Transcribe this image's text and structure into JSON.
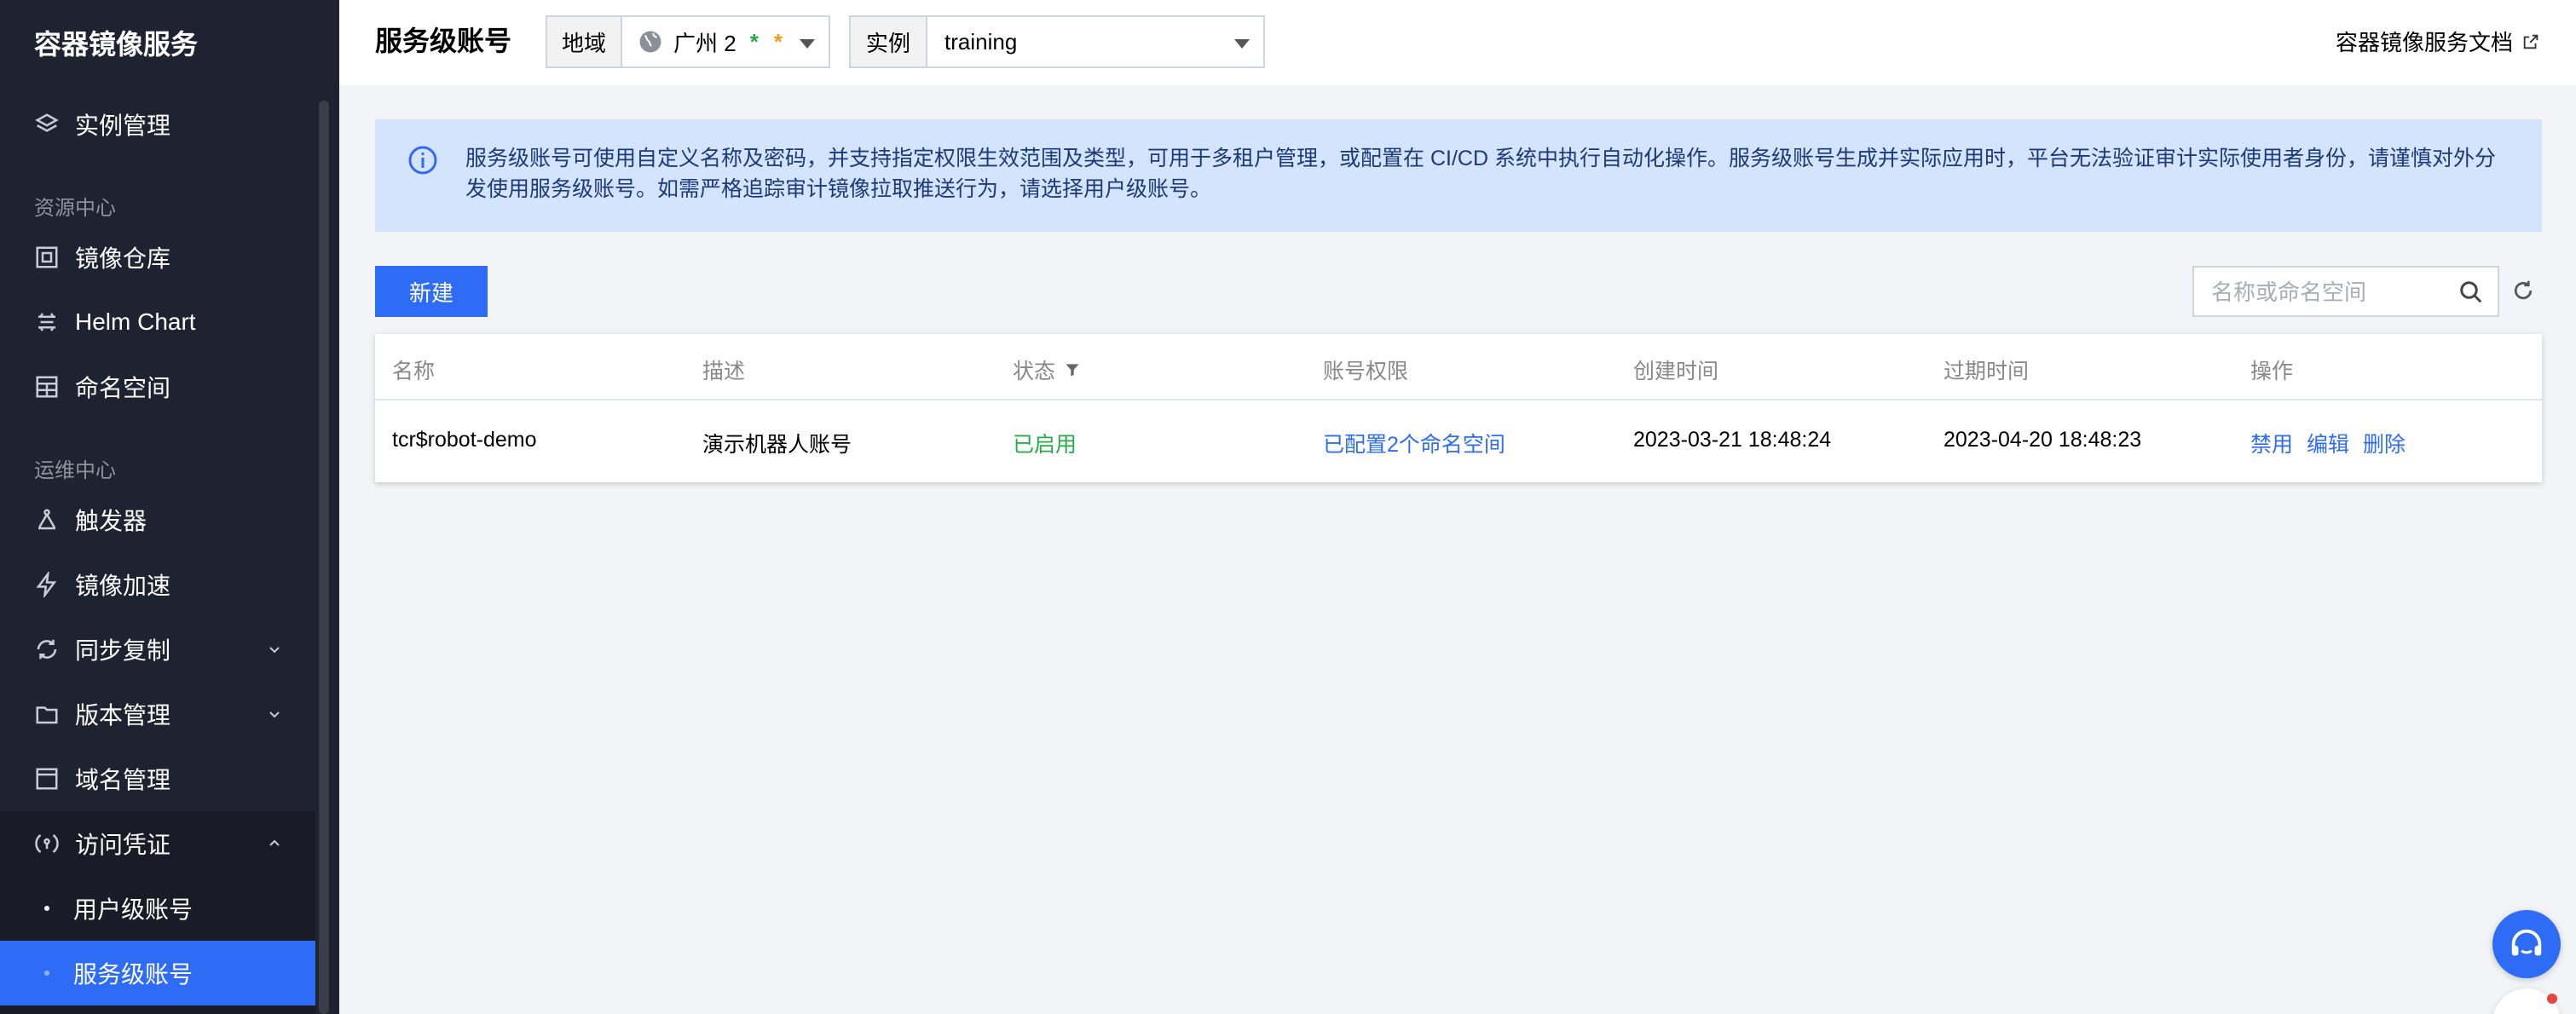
{
  "sidebar": {
    "title": "容器镜像服务",
    "items": {
      "instance": "实例管理",
      "section_resource": "资源中心",
      "repo": "镜像仓库",
      "helm": "Helm Chart",
      "namespace": "命名空间",
      "section_ops": "运维中心",
      "trigger": "触发器",
      "accel": "镜像加速",
      "sync": "同步复制",
      "version": "版本管理",
      "domain": "域名管理",
      "credential": "访问凭证",
      "user_account": "用户级账号",
      "service_account": "服务级账号"
    }
  },
  "header": {
    "title": "服务级账号",
    "region_label": "地域",
    "region_value": "广州 2",
    "instance_label": "实例",
    "instance_value": "training",
    "doc_link": "容器镜像服务文档"
  },
  "notice": {
    "text": "服务级账号可使用自定义名称及密码，并支持指定权限生效范围及类型，可用于多租户管理，或配置在 CI/CD 系统中执行自动化操作。服务级账号生成并实际应用时，平台无法验证审计实际使用者身份，请谨慎对外分发使用服务级账号。如需严格追踪审计镜像拉取推送行为，请选择用户级账号。"
  },
  "toolbar": {
    "new_button": "新建",
    "search_placeholder": "名称或命名空间"
  },
  "table": {
    "headers": {
      "name": "名称",
      "desc": "描述",
      "status": "状态",
      "perm": "账号权限",
      "created": "创建时间",
      "expires": "过期时间",
      "ops": "操作"
    },
    "rows": [
      {
        "name": "tcr$robot-demo",
        "desc": "演示机器人账号",
        "status": "已启用",
        "perm": "已配置2个命名空间",
        "created": "2023-03-21 18:48:24",
        "expires": "2023-04-20 18:48:23",
        "actions": {
          "disable": "禁用",
          "edit": "编辑",
          "delete": "删除"
        }
      }
    ]
  },
  "colors": {
    "sidebar_bg": "#1f2331",
    "accent": "#2f6cf6",
    "status_green": "#29a94a",
    "notice_bg": "#d5e4fd"
  }
}
